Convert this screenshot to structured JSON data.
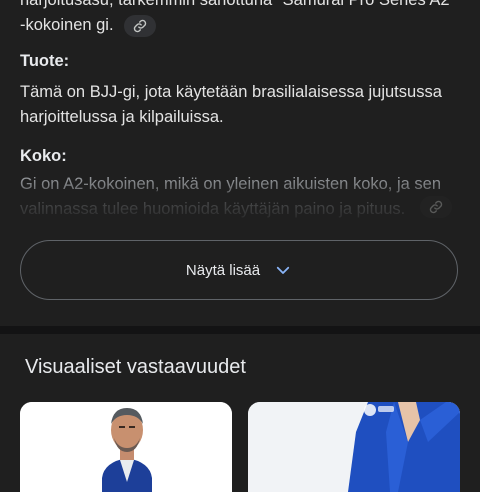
{
  "answer": {
    "intro_text": "harjoitusasu, tarkemmin sanottuna \"Samurai Pro Series A2\" -kokoinen gi.",
    "sections": [
      {
        "heading": "Tuote:",
        "text": "Tämä on BJJ-gi, jota käytetään brasilialaisessa jujutsussa harjoittelussa ja kilpailuissa."
      },
      {
        "heading": "Koko:",
        "text": "Gi on A2-kokoinen, mikä on yleinen aikuisten koko, ja sen valinnassa tulee huomioida käyttäjän paino ja pituus."
      }
    ],
    "link_icon": "link-icon",
    "show_more_label": "Näytä lisää",
    "show_more_icon": "chevron-down-icon"
  },
  "visual_matches": {
    "title": "Visuaaliset vastaavuudet",
    "items": [
      {
        "description": "man-in-blue-gi-photo"
      },
      {
        "description": "blue-gi-closeup-photo"
      }
    ]
  },
  "colors": {
    "background": "#1f1f1f",
    "text": "#e3e3e3",
    "accent_chevron": "#8ab4f8",
    "gi_blue": "#1f4fc0"
  }
}
